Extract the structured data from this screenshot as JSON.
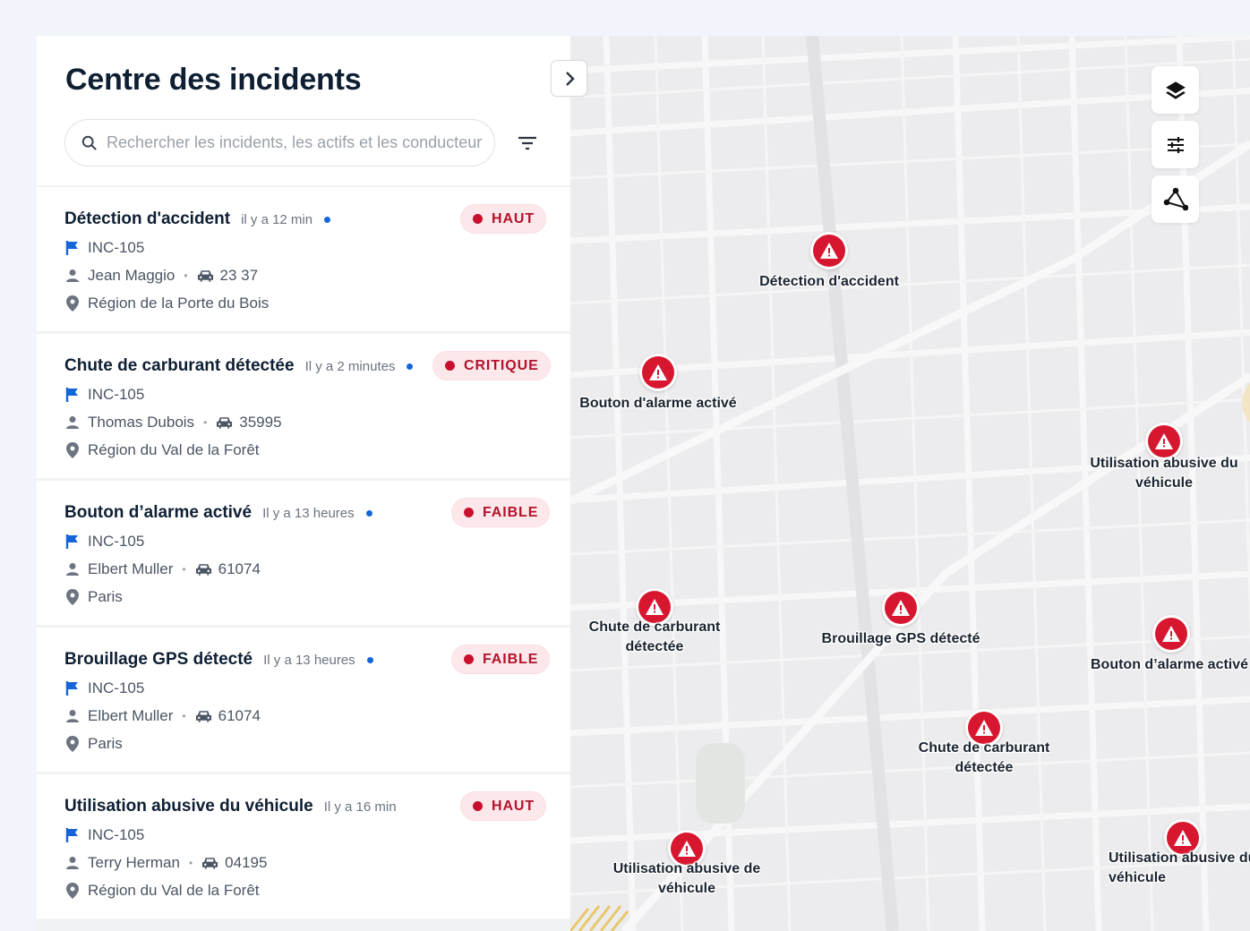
{
  "header": {
    "title": "Centre des incidents",
    "search_placeholder": "Rechercher les incidents, les actifs et les conducteurs"
  },
  "icons": {
    "search": "search-icon",
    "filter": "filter-icon",
    "collapse": "chevron-right-icon",
    "flag": "flag-icon",
    "driver": "person-icon",
    "vehicle": "car-icon",
    "location": "location-pin-icon",
    "layers": "layers-icon",
    "settings": "sliders-icon",
    "draw": "polygon-icon",
    "alert": "warning-triangle-icon"
  },
  "colors": {
    "accent_blue": "#1565d8",
    "alert_red": "#d7172f",
    "badge_bg": "#fce8ea",
    "badge_text": "#b3122d"
  },
  "incidents": [
    {
      "title": "Détection d'accident",
      "time": "il y a 12 min",
      "severity": "HAUT",
      "ref": "INC-105",
      "driver": "Jean Maggio",
      "vehicle": "23 37",
      "location": "Région de la Porte du Bois",
      "unread": true
    },
    {
      "title": "Chute de carburant détectée",
      "time": "Il y a 2 minutes",
      "severity": "CRITIQUE",
      "ref": "INC-105",
      "driver": "Thomas Dubois",
      "vehicle": "35995",
      "location": "Région du Val de la Forêt",
      "unread": true
    },
    {
      "title": "Bouton d’alarme activé",
      "time": "Il y a 13 heures",
      "severity": "FAIBLE",
      "ref": "INC-105",
      "driver": "Elbert Muller",
      "vehicle": "61074",
      "location": "Paris",
      "unread": true
    },
    {
      "title": "Brouillage GPS détecté",
      "time": "Il y a 13 heures",
      "severity": "FAIBLE",
      "ref": "INC-105",
      "driver": "Elbert Muller",
      "vehicle": "61074",
      "location": "Paris",
      "unread": true
    },
    {
      "title": "Utilisation abusive du véhicule",
      "time": "Il y a 16 min",
      "severity": "HAUT",
      "ref": "INC-105",
      "driver": "Terry Herman",
      "vehicle": "04195",
      "location": "Région du Val de la Forêt",
      "unread": false
    }
  ],
  "map_markers": [
    {
      "label": "Détection d'accident"
    },
    {
      "label": "Bouton d'alarme activé"
    },
    {
      "label": "Utilisation abusive du véhicule"
    },
    {
      "label": "Chute de carburant détectée"
    },
    {
      "label": "Brouillage GPS détecté"
    },
    {
      "label": "Bouton d’alarme activé"
    },
    {
      "label": "Chute de carburant détectée"
    },
    {
      "label": "Utilisation abusive de véhicule"
    },
    {
      "label": "Utilisation abusive du véhicule"
    }
  ]
}
